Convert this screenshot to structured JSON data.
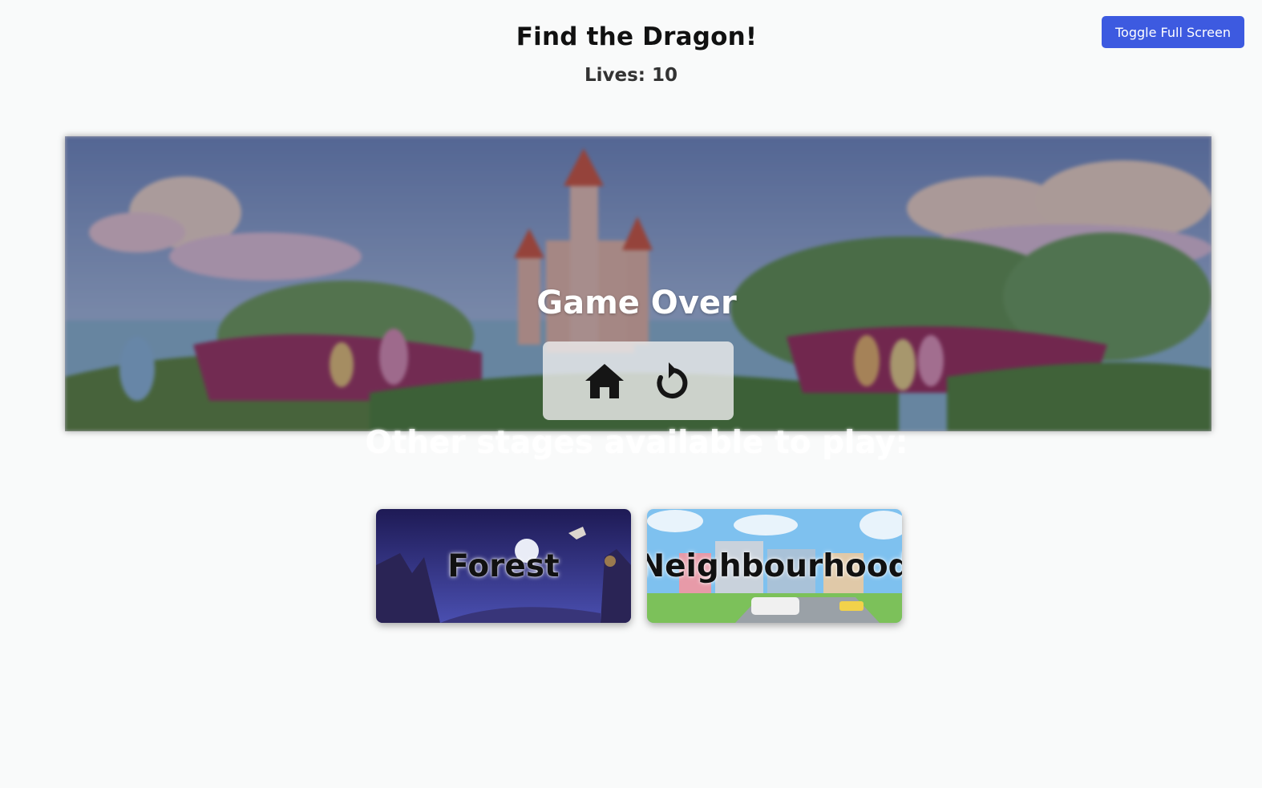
{
  "header": {
    "title": "Find the Dragon!",
    "lives_text": "Lives: 10",
    "fullscreen_label": "Toggle Full Screen"
  },
  "game": {
    "status": "Game Over",
    "home_icon": "home-icon",
    "restart_icon": "restart-icon"
  },
  "other_stages": {
    "heading": "Other stages available to play:",
    "items": [
      {
        "label": "Forest"
      },
      {
        "label": "Neighbourhood"
      }
    ]
  },
  "colors": {
    "accent": "#3d5ae0",
    "background": "#f9fafa"
  }
}
